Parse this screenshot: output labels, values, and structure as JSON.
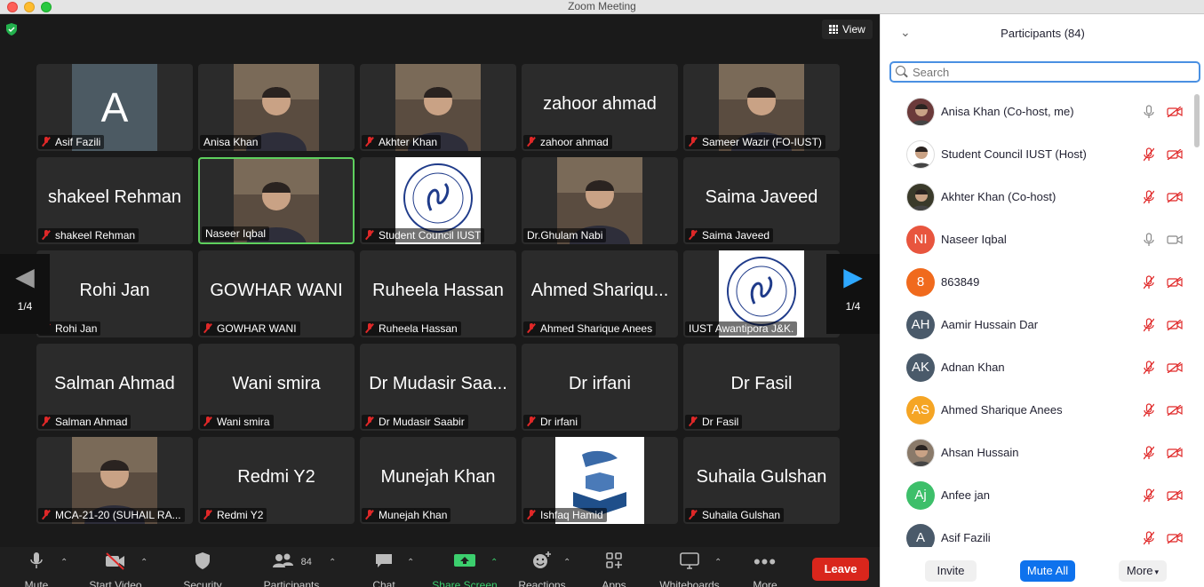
{
  "window": {
    "title": "Zoom Meeting"
  },
  "meeting": {
    "view_label": "View",
    "page_indicator": "1/4",
    "tiles": [
      {
        "id": "t1",
        "label": "Asif Fazili",
        "big": "",
        "kind": "avatar",
        "avatar_letter": "A",
        "muted": true
      },
      {
        "id": "t2",
        "label": "Anisa Khan",
        "big": "",
        "kind": "photo",
        "muted": false
      },
      {
        "id": "t3",
        "label": "Akhter Khan",
        "big": "",
        "kind": "photo",
        "muted": true
      },
      {
        "id": "t4",
        "label": "zahoor ahmad",
        "big": "zahoor ahmad",
        "kind": "name",
        "muted": true
      },
      {
        "id": "t5",
        "label": "Sameer Wazir (FO-IUST)",
        "big": "",
        "kind": "photo",
        "muted": true
      },
      {
        "id": "t6",
        "label": "shakeel Rehman",
        "big": "shakeel Rehman",
        "kind": "name",
        "muted": true
      },
      {
        "id": "t7",
        "label": "Naseer Iqbal",
        "big": "",
        "kind": "photo",
        "muted": false,
        "active": true
      },
      {
        "id": "t8",
        "label": "Student Council IUST",
        "big": "",
        "kind": "logo",
        "muted": true
      },
      {
        "id": "t9",
        "label": "Dr.Ghulam Nabi",
        "big": "",
        "kind": "photo",
        "muted": false
      },
      {
        "id": "t10",
        "label": "Saima Javeed",
        "big": "Saima Javeed",
        "kind": "name",
        "muted": true
      },
      {
        "id": "t11",
        "label": "Rohi Jan",
        "big": "Rohi Jan",
        "kind": "name",
        "muted": true
      },
      {
        "id": "t12",
        "label": "GOWHAR WANI",
        "big": "GOWHAR WANI",
        "kind": "name",
        "muted": true
      },
      {
        "id": "t13",
        "label": "Ruheela Hassan",
        "big": "Ruheela Hassan",
        "kind": "name",
        "muted": true
      },
      {
        "id": "t14",
        "label": "Ahmed Sharique Anees",
        "big": "Ahmed Shariqu...",
        "kind": "name",
        "muted": true
      },
      {
        "id": "t15",
        "label": "IUST Awantipora J&K.",
        "big": "",
        "kind": "logo",
        "muted": false
      },
      {
        "id": "t16",
        "label": "Salman Ahmad",
        "big": "Salman Ahmad",
        "kind": "name",
        "muted": true
      },
      {
        "id": "t17",
        "label": "Wani smira",
        "big": "Wani smira",
        "kind": "name",
        "muted": true
      },
      {
        "id": "t18",
        "label": "Dr Mudasir Saabir",
        "big": "Dr Mudasir Saa...",
        "kind": "name",
        "muted": true
      },
      {
        "id": "t19",
        "label": "Dr irfani",
        "big": "Dr irfani",
        "kind": "name",
        "muted": true
      },
      {
        "id": "t20",
        "label": "Dr Fasil",
        "big": "Dr Fasil",
        "kind": "name",
        "muted": true
      },
      {
        "id": "t21",
        "label": "MCA-21-20 (SUHAIL RA...",
        "big": "",
        "kind": "photo",
        "muted": true
      },
      {
        "id": "t22",
        "label": "Redmi Y2",
        "big": "Redmi Y2",
        "kind": "name",
        "muted": true
      },
      {
        "id": "t23",
        "label": "Munejah Khan",
        "big": "Munejah Khan",
        "kind": "name",
        "muted": true
      },
      {
        "id": "t24",
        "label": "Ishfaq Hamid",
        "big": "",
        "kind": "quran",
        "muted": true
      },
      {
        "id": "t25",
        "label": "Suhaila Gulshan",
        "big": "Suhaila Gulshan",
        "kind": "name",
        "muted": true
      }
    ]
  },
  "toolbar": {
    "mute": "Mute",
    "start_video": "Start Video",
    "security": "Security",
    "participants": "Participants",
    "participants_count": "84",
    "chat": "Chat",
    "share_screen": "Share Screen",
    "reactions": "Reactions",
    "apps": "Apps",
    "whiteboards": "Whiteboards",
    "more": "More",
    "leave": "Leave"
  },
  "panel": {
    "title": "Participants (84)",
    "search_placeholder": "Search",
    "participants": [
      {
        "name": "Anisa Khan (Co-host, me)",
        "initials": "",
        "color": "#6b3a3a",
        "mic_on": true,
        "cam_off": true
      },
      {
        "name": "Student Council IUST (Host)",
        "initials": "",
        "color": "#ffffff",
        "mic_on": false,
        "cam_off": true
      },
      {
        "name": "Akhter Khan (Co-host)",
        "initials": "",
        "color": "#3a3a2a",
        "mic_on": false,
        "cam_off": true
      },
      {
        "name": "Naseer Iqbal",
        "initials": "NI",
        "color": "#e8553e",
        "mic_on": true,
        "cam_off": false
      },
      {
        "name": "863849",
        "initials": "8",
        "color": "#f06a1d",
        "mic_on": false,
        "cam_off": true
      },
      {
        "name": "Aamir Hussain Dar",
        "initials": "AH",
        "color": "#4a5a6a",
        "mic_on": false,
        "cam_off": true
      },
      {
        "name": "Adnan Khan",
        "initials": "AK",
        "color": "#4a5a6a",
        "mic_on": false,
        "cam_off": true
      },
      {
        "name": "Ahmed Sharique Anees",
        "initials": "AS",
        "color": "#f5a524",
        "mic_on": false,
        "cam_off": true
      },
      {
        "name": "Ahsan Hussain",
        "initials": "",
        "color": "#8a7a6a",
        "mic_on": false,
        "cam_off": true
      },
      {
        "name": "Anfee jan",
        "initials": "Aj",
        "color": "#3dbf6a",
        "mic_on": false,
        "cam_off": true
      },
      {
        "name": "Asif Fazili",
        "initials": "A",
        "color": "#4a5a6a",
        "mic_on": false,
        "cam_off": true
      }
    ],
    "invite": "Invite",
    "mute_all": "Mute All",
    "more": "More"
  }
}
